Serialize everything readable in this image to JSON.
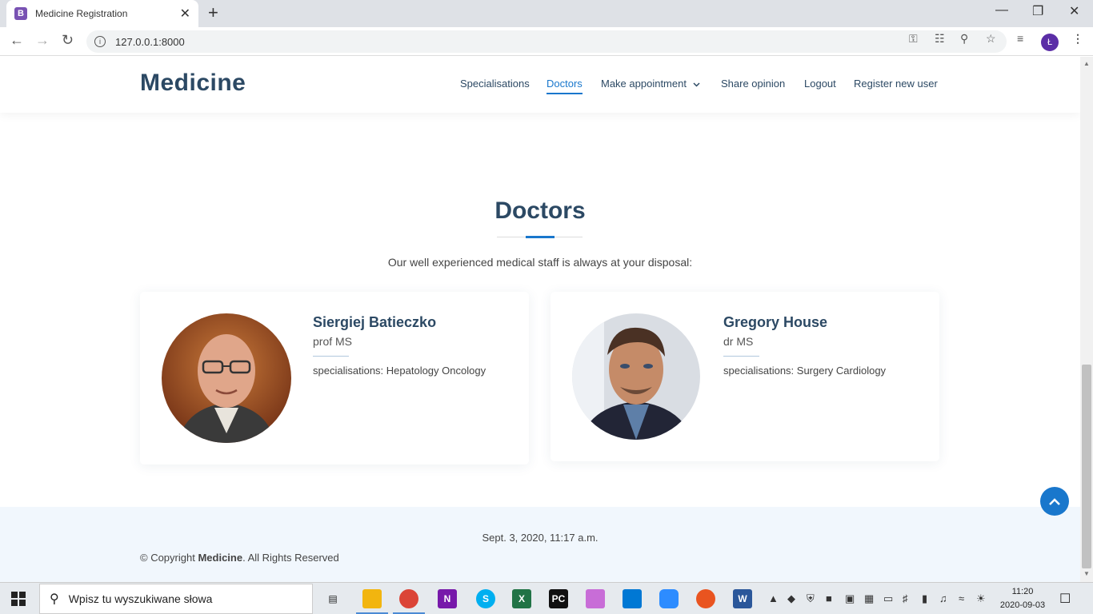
{
  "browser": {
    "tab_title": "Medicine Registration",
    "favicon_letter": "B",
    "new_tab": "+",
    "close_tab": "✕",
    "url": "127.0.0.1:8000",
    "profile_initial": "Ł"
  },
  "site": {
    "logo": "Medicine",
    "nav": [
      {
        "label": "Specialisations"
      },
      {
        "label": "Doctors"
      },
      {
        "label": "Make appointment"
      },
      {
        "label": "Share opinion"
      },
      {
        "label": "Logout"
      },
      {
        "label": "Register new user"
      }
    ],
    "active_nav": "Doctors"
  },
  "section": {
    "title": "Doctors",
    "subtitle": "Our well experienced medical staff is always at your disposal:"
  },
  "doctors": [
    {
      "name": "Siergiej Batieczko",
      "title": "prof MS",
      "specialisations": "specialisations: Hepatology Oncology"
    },
    {
      "name": "Gregory House",
      "title": "dr MS",
      "specialisations": "specialisations: Surgery Cardiology"
    }
  ],
  "footer": {
    "date": "Sept. 3, 2020, 11:17 a.m.",
    "copyright_prefix": "© Copyright ",
    "copyright_brand": "Medicine",
    "copyright_suffix": ". All Rights Reserved"
  },
  "taskbar": {
    "search_placeholder": "Wpisz tu wyszukiwane słowa",
    "time": "11:20",
    "date": "2020-09-03"
  },
  "colors": {
    "brand_dark": "#2c4964",
    "accent": "#1977cc",
    "footer_bg": "#f1f7fd"
  }
}
